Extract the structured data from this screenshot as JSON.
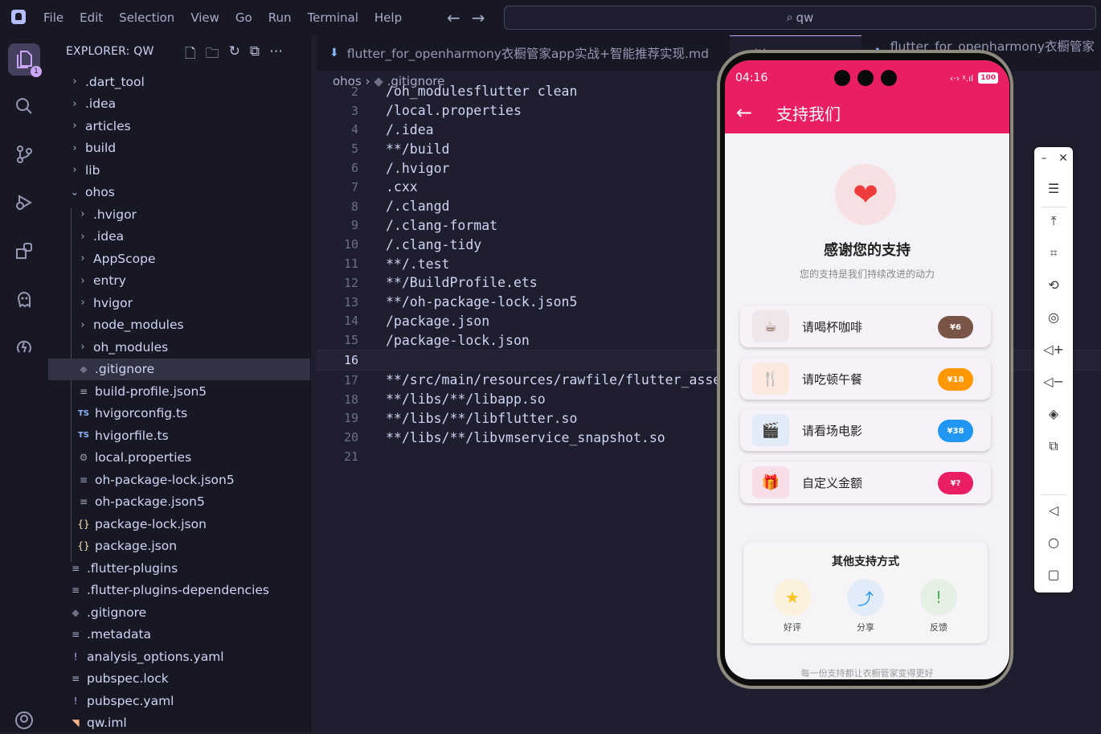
{
  "menu": [
    "File",
    "Edit",
    "Selection",
    "View",
    "Go",
    "Run",
    "Terminal",
    "Help"
  ],
  "search": {
    "text": "qw"
  },
  "explorer": {
    "title": "EXPLORER: QW",
    "tree": [
      {
        "label": ".dart_tool",
        "type": "folder",
        "indent": 0,
        "open": false
      },
      {
        "label": ".idea",
        "type": "folder",
        "indent": 0,
        "open": false
      },
      {
        "label": "articles",
        "type": "folder",
        "indent": 0,
        "open": false
      },
      {
        "label": "build",
        "type": "folder",
        "indent": 0,
        "open": false
      },
      {
        "label": "lib",
        "type": "folder",
        "indent": 0,
        "open": false
      },
      {
        "label": "ohos",
        "type": "folder",
        "indent": 0,
        "open": true
      },
      {
        "label": ".hvigor",
        "type": "folder",
        "indent": 1,
        "open": false
      },
      {
        "label": ".idea",
        "type": "folder",
        "indent": 1,
        "open": false
      },
      {
        "label": "AppScope",
        "type": "folder",
        "indent": 1,
        "open": false
      },
      {
        "label": "entry",
        "type": "folder",
        "indent": 1,
        "open": false
      },
      {
        "label": "hvigor",
        "type": "folder",
        "indent": 1,
        "open": false
      },
      {
        "label": "node_modules",
        "type": "folder",
        "indent": 1,
        "open": false
      },
      {
        "label": "oh_modules",
        "type": "folder",
        "indent": 1,
        "open": false
      },
      {
        "label": ".gitignore",
        "type": "git",
        "indent": 1,
        "selected": true
      },
      {
        "label": "build-profile.json5",
        "type": "lines",
        "indent": 1
      },
      {
        "label": "hvigorconfig.ts",
        "type": "ts",
        "indent": 1
      },
      {
        "label": "hvigorfile.ts",
        "type": "ts",
        "indent": 1
      },
      {
        "label": "local.properties",
        "type": "gear",
        "indent": 1
      },
      {
        "label": "oh-package-lock.json5",
        "type": "lines",
        "indent": 1
      },
      {
        "label": "oh-package.json5",
        "type": "lines",
        "indent": 1
      },
      {
        "label": "package-lock.json",
        "type": "json",
        "indent": 1
      },
      {
        "label": "package.json",
        "type": "json",
        "indent": 1
      },
      {
        "label": ".flutter-plugins",
        "type": "lines",
        "indent": 0
      },
      {
        "label": ".flutter-plugins-dependencies",
        "type": "lines",
        "indent": 0
      },
      {
        "label": ".gitignore",
        "type": "git",
        "indent": 0
      },
      {
        "label": ".metadata",
        "type": "lines",
        "indent": 0
      },
      {
        "label": "analysis_options.yaml",
        "type": "yaml",
        "indent": 0
      },
      {
        "label": "pubspec.lock",
        "type": "lines",
        "indent": 0
      },
      {
        "label": "pubspec.yaml",
        "type": "yaml",
        "indent": 0
      },
      {
        "label": "qw.iml",
        "type": "rss",
        "indent": 0
      }
    ]
  },
  "tabs": [
    {
      "label": "flutter_for_openharmony衣橱管家app实战+智能推荐实现.md",
      "active": false
    },
    {
      "label": ".gitignore",
      "active": true
    },
    {
      "label": "flutter_for_openharmony衣橱管家app",
      "active": false
    }
  ],
  "breadcrumb": {
    "folder": "ohos",
    "file": ".gitignore"
  },
  "code": [
    {
      "n": "2",
      "text": "/oh_modulesflutter clean"
    },
    {
      "n": "3",
      "text": "/local.properties"
    },
    {
      "n": "4",
      "text": "/.idea"
    },
    {
      "n": "5",
      "text": "**/build"
    },
    {
      "n": "6",
      "text": "/.hvigor"
    },
    {
      "n": "7",
      "text": ".cxx"
    },
    {
      "n": "8",
      "text": "/.clangd"
    },
    {
      "n": "9",
      "text": "/.clang-format"
    },
    {
      "n": "10",
      "text": "/.clang-tidy"
    },
    {
      "n": "11",
      "text": "**/.test"
    },
    {
      "n": "12",
      "text": "**/BuildProfile.ets"
    },
    {
      "n": "13",
      "text": "**/oh-package-lock.json5"
    },
    {
      "n": "14",
      "text": "/package.json"
    },
    {
      "n": "15",
      "text": "/package-lock.json"
    },
    {
      "n": "16",
      "text": "",
      "current": true
    },
    {
      "n": "17",
      "text": "**/src/main/resources/rawfile/flutter_asset"
    },
    {
      "n": "18",
      "text": "**/libs/**/libapp.so"
    },
    {
      "n": "19",
      "text": "**/libs/**/libflutter.so"
    },
    {
      "n": "20",
      "text": "**/libs/**/libvmservice_snapshot.so"
    },
    {
      "n": "21",
      "text": ""
    }
  ],
  "phone": {
    "time": "04:16",
    "battery": "100",
    "appbar_title": "支持我们",
    "thanks_title": "感谢您的支持",
    "thanks_sub": "您的支持是我们持续改进的动力",
    "options": [
      {
        "label": "请喝杯咖啡",
        "price": "¥6",
        "icon": "coffee-icon",
        "glyph": "☕",
        "color": "#7a5547",
        "bg": "#efe6ea"
      },
      {
        "label": "请吃顿午餐",
        "price": "¥18",
        "icon": "fork-knife-icon",
        "glyph": "🍴",
        "color": "#ff9800",
        "bg": "#fbe9dd"
      },
      {
        "label": "请看场电影",
        "price": "¥38",
        "icon": "movie-icon",
        "glyph": "🎬",
        "color": "#2196f3",
        "bg": "#e2ecf8"
      },
      {
        "label": "自定义金额",
        "price": "¥?",
        "icon": "gift-icon",
        "glyph": "🎁",
        "color": "#e91e63",
        "bg": "#f7dde7"
      }
    ],
    "other_title": "其他支持方式",
    "other": [
      {
        "label": "好评",
        "icon": "star-icon",
        "glyph": "★",
        "color": "#f9c21f",
        "bg": "#fbf1dc"
      },
      {
        "label": "分享",
        "icon": "share-icon",
        "glyph": "⤴",
        "color": "#2196f3",
        "bg": "#e1ecf8"
      },
      {
        "label": "反馈",
        "icon": "feedback-icon",
        "glyph": "!",
        "color": "#4caf50",
        "bg": "#e3f0e3"
      }
    ],
    "footer": "每一份支持都让衣橱管家变得更好"
  },
  "colors": {
    "brand": "#ea1e63",
    "accent": "#cba6f7"
  }
}
